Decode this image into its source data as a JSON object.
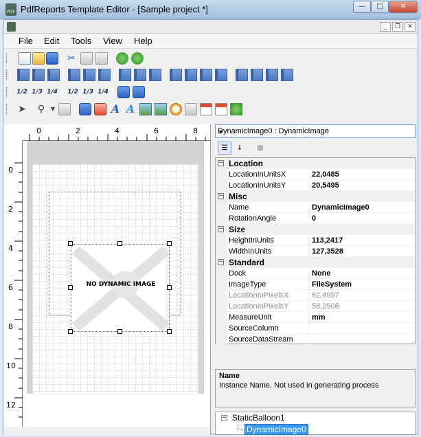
{
  "window": {
    "title": "PdfReports Template Editor - [Sample project *]",
    "app_icon_label": "PDF",
    "controls": [
      "minimize-icon",
      "maximize-icon",
      "close-icon"
    ]
  },
  "mdi": {
    "controls": [
      "minimize-icon",
      "restore-icon",
      "close-icon"
    ]
  },
  "menu": {
    "items": [
      "File",
      "Edit",
      "Tools",
      "View",
      "Help"
    ]
  },
  "toolbars": {
    "fractions": [
      "1/2",
      "1/3",
      "1/4",
      "1/2",
      "1/3",
      "1/4"
    ],
    "text_tool": "A"
  },
  "designer": {
    "ruler_top": [
      "0",
      "2",
      "4",
      "6",
      "8"
    ],
    "ruler_left": [
      "0",
      "2",
      "4",
      "6",
      "8",
      "10",
      "12"
    ],
    "image_placeholder_text": "NO DYNAMIC IMAGE"
  },
  "properties": {
    "selected_object": "DynamicImage0 : DynamicImage",
    "categories": [
      {
        "name": "Location",
        "rows": [
          {
            "name": "LocationInUnitsX",
            "value": "22,0485"
          },
          {
            "name": "LocationInUnitsY",
            "value": "20,5495"
          }
        ]
      },
      {
        "name": "Misc",
        "rows": [
          {
            "name": "Name",
            "value": "DynamicImage0"
          },
          {
            "name": "RotationAngle",
            "value": "0"
          }
        ]
      },
      {
        "name": "Size",
        "rows": [
          {
            "name": "HeightInUnits",
            "value": "113,2417"
          },
          {
            "name": "WidthInUnits",
            "value": "127,3528"
          }
        ]
      },
      {
        "name": "Standard",
        "rows": [
          {
            "name": "Dock",
            "value": "None"
          },
          {
            "name": "ImageType",
            "value": "FileSystem"
          },
          {
            "name": "LocationInPixelsX",
            "value": "62,4997",
            "readonly": true
          },
          {
            "name": "LocationInPixelsY",
            "value": "58,2506",
            "readonly": true
          },
          {
            "name": "MeasureUnit",
            "value": "mm"
          },
          {
            "name": "SourceColumn",
            "value": ""
          },
          {
            "name": "SourceDataStream",
            "value": ""
          }
        ]
      }
    ],
    "description": {
      "title": "Name",
      "text": "Instance Name. Not used in generating process"
    }
  },
  "tree": {
    "root": "StaticBalloon1",
    "child": "DynamicImage0"
  }
}
